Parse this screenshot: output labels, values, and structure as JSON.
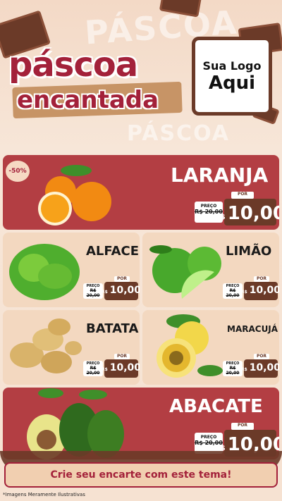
{
  "header": {
    "title_main": "páscoa",
    "title_sub": "encantada",
    "watermark_top": "PÁSCOA",
    "watermark_mid": "PÁSCOA",
    "logo_line1": "Sua Logo",
    "logo_line2": "Aqui"
  },
  "colors": {
    "accent_red": "#b33e43",
    "chocolate": "#6b3a28",
    "beige": "#f3d8c0"
  },
  "discount_badge": "-50%",
  "products": [
    {
      "name": "LARANJA",
      "por": "POR",
      "preco_label": "PREÇO",
      "old": "R$ 20,00",
      "currency": "R$",
      "price": "10,00"
    },
    {
      "name": "ALFACE",
      "por": "POR",
      "preco_label": "PREÇO",
      "old": "R$ 20,00",
      "currency": "R$",
      "price": "10,00"
    },
    {
      "name": "LIMÃO",
      "por": "POR",
      "preco_label": "PREÇO",
      "old": "R$ 20,00",
      "currency": "R$",
      "price": "10,00"
    },
    {
      "name": "BATATA",
      "por": "POR",
      "preco_label": "PREÇO",
      "old": "R$ 20,00",
      "currency": "R$",
      "price": "10,00"
    },
    {
      "name": "MARACUJÁ",
      "por": "POR",
      "preco_label": "PREÇO",
      "old": "R$ 20,00",
      "currency": "R$",
      "price": "10,00"
    },
    {
      "name": "ABACATE",
      "por": "POR",
      "preco_label": "PREÇO",
      "old": "R$ 20,00",
      "currency": "R$",
      "price": "10,00"
    }
  ],
  "footer": {
    "cta": "Crie seu encarte com este tema!",
    "disclaimer": "*Imagens Meramente Ilustrativas"
  }
}
